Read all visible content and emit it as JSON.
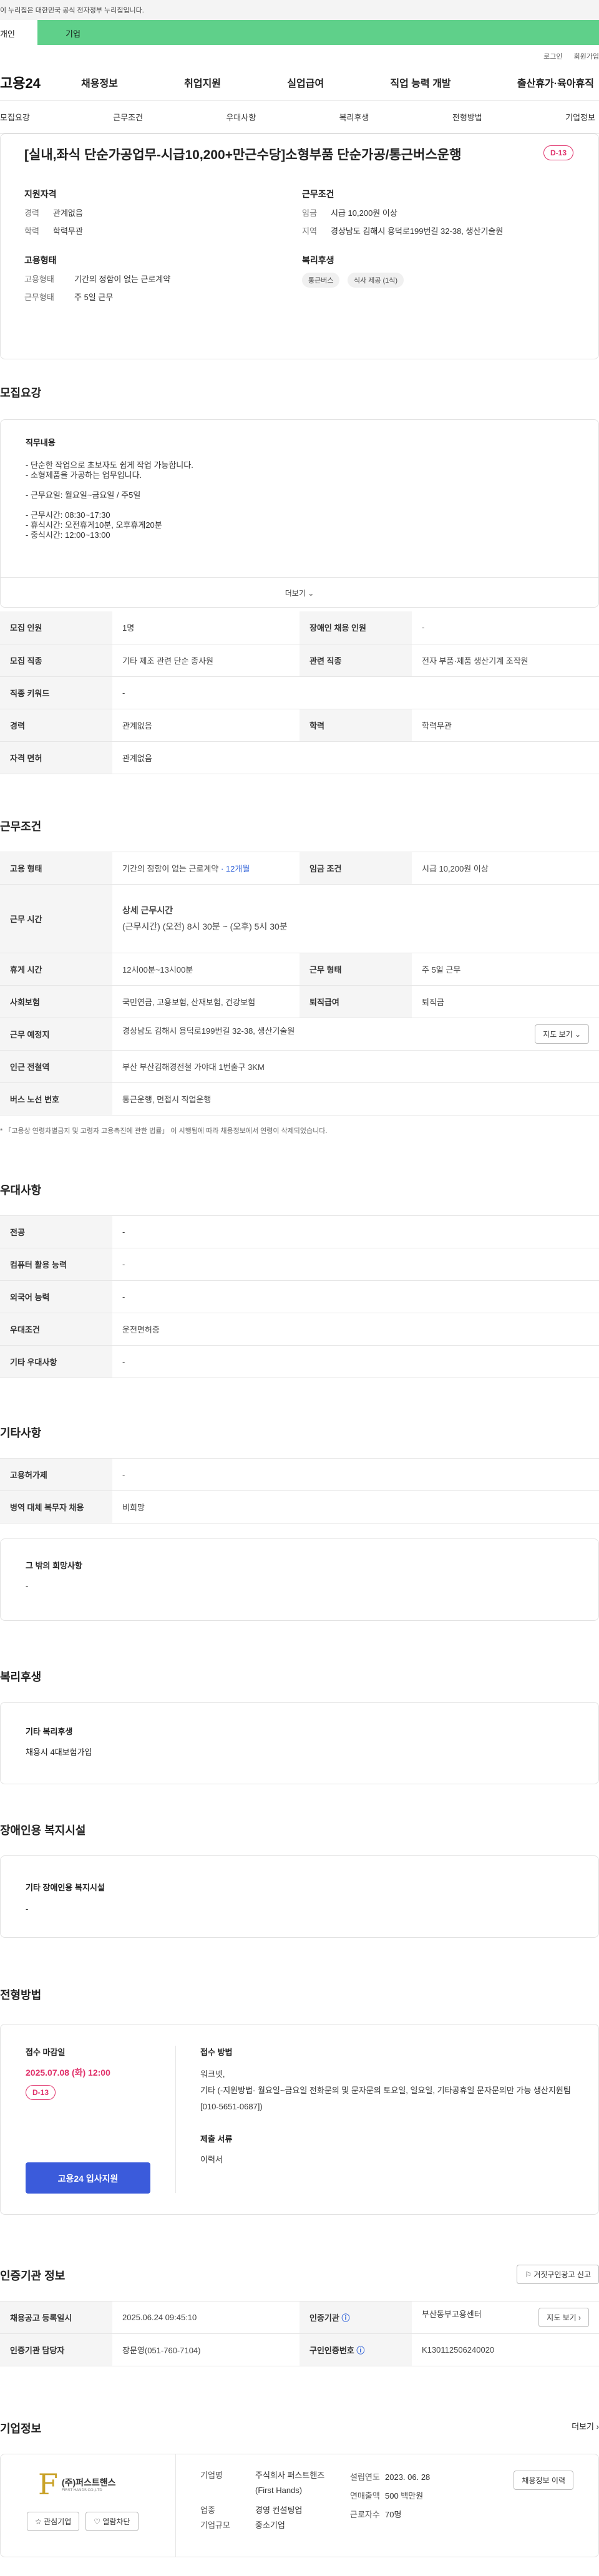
{
  "notice": "이 누리집은 대한민국 공식 전자정부 누리집입니다.",
  "tabs": {
    "individual": "개인",
    "business": "기업"
  },
  "toplinks": {
    "login": "로그인",
    "join": "회원가입"
  },
  "logo": "고용24",
  "gnb": [
    "채용정보",
    "취업지원",
    "실업급여",
    "직업 능력 개발",
    "출산휴가·육아휴직"
  ],
  "subnav": [
    "모집요강",
    "근무조건",
    "우대사항",
    "복리후생",
    "전형방법",
    "기업정보"
  ],
  "summary": {
    "title": "[실내,좌식 단순가공업무-시급10,200+만근수당]소형부품 단순가공/통근버스운행",
    "dday": "D-13",
    "qual_h": "지원자격",
    "career_k": "경력",
    "career_v": "관계없음",
    "edu_k": "학력",
    "edu_v": "학력무관",
    "emptype_h": "고용형태",
    "emp_k": "고용형태",
    "emp_v": "기간의 정함이 없는 근로계약",
    "work_k": "근무형태",
    "work_v": "주 5일 근무",
    "cond_h": "근무조건",
    "wage_k": "임금",
    "wage_v": "시급 10,200원 이상",
    "region_k": "지역",
    "region_v": "경상남도 김해시 용덕로199번길 32-38, 생산기술원",
    "welfare_h": "복리후생",
    "chips": [
      "통근버스",
      "식사 제공 (1식)"
    ]
  },
  "recruit": {
    "title": "모집요강",
    "duty_h": "직무내용",
    "duty_lines": [
      "- 단순한 작업으로 초보자도 쉽게 작업 가능합니다.",
      "- 소형제품을 가공하는 업무입니다.",
      "",
      "- 근무요일: 월요일~금요일 / 주5일",
      "",
      "- 근무시간: 08:30~17:30",
      "- 휴식시간: 오전휴게10분, 오후휴게20분",
      "- 중식시간: 12:00~13:00"
    ],
    "more": "더보기",
    "rows": [
      [
        "모집 인원",
        "1명",
        "장애인 채용 인원",
        "-"
      ],
      [
        "모집 직종",
        "기타 제조 관련 단순 종사원",
        "관련 직종",
        "전자 부품·제품 생산기계 조작원"
      ],
      [
        "직종 키워드",
        "-",
        "",
        ""
      ],
      [
        "경력",
        "관계없음",
        "학력",
        "학력무관"
      ],
      [
        "자격 면허",
        "관계없음",
        "",
        ""
      ]
    ]
  },
  "conditions": {
    "title": "근무조건",
    "emp_k": "고용 형태",
    "emp_v": "기간의 정함이 없는 근로계약",
    "emp_extra": "· 12개월",
    "wage_k": "임금 조건",
    "wage_v": "시급 10,200원 이상",
    "time_k": "근무 시간",
    "time_h": "상세 근무시간",
    "time_v": "(근무시간) (오전) 8시 30분 ~ (오후) 5시 30분",
    "rest_k": "휴게 시간",
    "rest_v": "12시00분~13시00분",
    "form_k": "근무 형태",
    "form_v": "주 5일 근무",
    "ins_k": "사회보험",
    "ins_v": "국민연금, 고용보험, 산재보험, 건강보험",
    "ret_k": "퇴직급여",
    "ret_v": "퇴직금",
    "place_k": "근무 예정지",
    "place_v": "경상남도 김해시 용덕로199번길 32-38, 생산기술원",
    "map_btn": "지도 보기",
    "subway_k": "인근 전철역",
    "subway_v": "부산 부산김해경전철 가야대 1번출구 3KM",
    "bus_k": "버스 노선 번호",
    "bus_v": "통근운행, 면접시 직업운행",
    "note": "* 「고용상 연령차별금지 및 고령자 고용촉진에 관한 법률」 이 시행됨에 따라 채용정보에서 연령이 삭제되었습니다."
  },
  "prefer": {
    "title": "우대사항",
    "rows": [
      [
        "전공",
        "-"
      ],
      [
        "컴퓨터 활용 능력",
        "-"
      ],
      [
        "외국어 능력",
        "-"
      ],
      [
        "우대조건",
        "운전면허증"
      ],
      [
        "기타 우대사항",
        "-"
      ]
    ]
  },
  "etc": {
    "title": "기타사항",
    "rows": [
      [
        "고용허가제",
        "-"
      ],
      [
        "병역 대체 복무자 채용",
        "비희망"
      ]
    ],
    "other_h": "그 밖의 희망사항",
    "other_v": "-"
  },
  "welfare": {
    "title": "복리후생",
    "sub_h": "기타 복리후생",
    "sub_v": "채용시 4대보험가입"
  },
  "disabled": {
    "title": "장애인용 복지시설",
    "sub_h": "기타 장애인용 복지시설",
    "sub_v": "-"
  },
  "process": {
    "title": "전형방법",
    "deadline_h": "접수 마감일",
    "deadline_v": "2025.07.08 (화) 12:00",
    "dday": "D-13",
    "apply_btn": "고용24 입사지원",
    "method_h": "접수 방법",
    "method_v1": "워크넷,",
    "method_v2": "기타 (-지원방법- 월요일~금요일 전화문의 및 문자문의 토요일, 일요일, 기타공휴일 문자문의만 가능 생산지원팀[010-5651-0687])",
    "docs_h": "제출 서류",
    "docs_v": "이력서"
  },
  "cert": {
    "title": "인증기관 정보",
    "report_btn": "거짓구인광고 신고",
    "reg_k": "채용공고 등록일시",
    "reg_v": "2025.06.24 09:45:10",
    "org_k": "인증기관",
    "org_v": "부산동부고용센터",
    "map_btn": "지도 보기",
    "mgr_k": "인증기관 담당자",
    "mgr_v": "장문영(051-760-7104)",
    "no_k": "구인인증번호",
    "no_v": "K130112506240020"
  },
  "company": {
    "title": "기업정보",
    "more": "더보기",
    "logo_text": "(주)퍼스트핸스",
    "logo_sub": "FIRST HANDS CO.,LTD",
    "fav_btn": "관심기업",
    "block_btn": "열람차단",
    "name_k": "기업명",
    "name_v": "주식회사 퍼스트핸즈(First Hands)",
    "found_k": "설립연도",
    "found_v": "2023. 06. 28",
    "sales_k": "연매출액",
    "sales_v": "500 백만원",
    "emp_k": "근로자수",
    "emp_v": "70명",
    "ind_k": "업종",
    "ind_v": "경영 컨설팅업",
    "size_k": "기업규모",
    "size_v": "중소기업",
    "jobs_btn": "채용정보 이력"
  }
}
